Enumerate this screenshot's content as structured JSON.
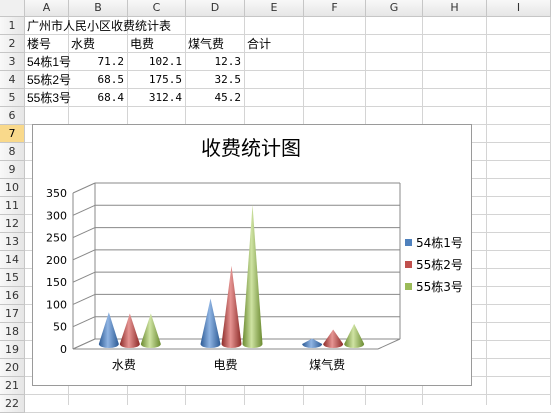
{
  "columns": [
    "A",
    "B",
    "C",
    "D",
    "E",
    "F",
    "G",
    "H",
    "I"
  ],
  "rows": [
    "1",
    "2",
    "3",
    "4",
    "5",
    "6",
    "7",
    "8",
    "9",
    "10",
    "11",
    "12",
    "13",
    "14",
    "15",
    "16",
    "17",
    "18",
    "19",
    "20",
    "21",
    "22"
  ],
  "active_row": "7",
  "cells": {
    "title": "广州市人民小区收费统计表",
    "headers": [
      "楼号",
      "水费",
      "电费",
      "煤气费",
      "合计"
    ],
    "data": [
      [
        "54栋1号",
        "71.2",
        "102.1",
        "12.3"
      ],
      [
        "55栋2号",
        "68.5",
        "175.5",
        "32.5"
      ],
      [
        "55栋3号",
        "68.4",
        "312.4",
        "45.2"
      ]
    ]
  },
  "chart_data": {
    "type": "bar",
    "title": "收费统计图",
    "categories": [
      "水费",
      "电费",
      "煤气费"
    ],
    "series": [
      {
        "name": "54栋1号",
        "values": [
          71.2,
          102.1,
          12.3
        ]
      },
      {
        "name": "55栋2号",
        "values": [
          68.5,
          175.5,
          32.5
        ]
      },
      {
        "name": "55栋3号",
        "values": [
          68.4,
          312.4,
          45.2
        ]
      }
    ],
    "ylim": [
      0,
      350
    ],
    "yticks": [
      "0",
      "50",
      "100",
      "150",
      "200",
      "250",
      "300",
      "350"
    ],
    "legend_position": "right",
    "grid": true,
    "colors": [
      "#4f81bd",
      "#c0504d",
      "#9bbb59"
    ]
  }
}
